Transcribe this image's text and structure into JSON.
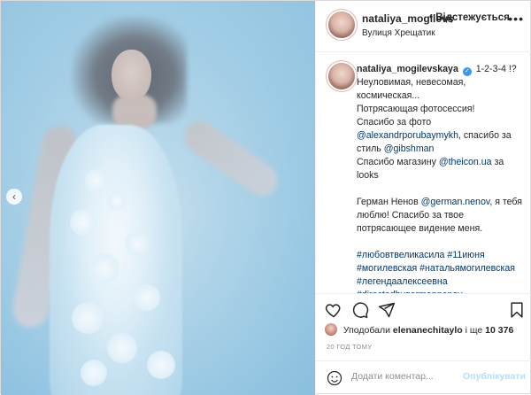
{
  "post": {
    "username": "nataliya_mogilevs",
    "follow_state": "• Відстежується",
    "location": "Вулиця Хрещатик",
    "more": "•••"
  },
  "caption": {
    "username": "nataliya_mogilevskaya",
    "verified": "✓",
    "line_intro": "1-2-3-4 !?",
    "text1": "Неуловимая, невесомая, космическая...",
    "text2": "Потрясающая фотосессия!",
    "text3": "Спасибо за фото",
    "mention_photo": "@alexandrporubaymykh",
    "text4": ", спасибо за стиль",
    "mention_style": "@gibshman",
    "text5": "Спасибо магазину",
    "mention_shop": "@theicon.ua",
    "text6": "за looks",
    "text7": "Герман Ненов",
    "mention_german": "@german.nenov",
    "text8": ", я тебя люблю! Спасибо за твое потрясающее видение меня.",
    "hashtags": "#любовтвеликасила #11июня #могилевская #натальямогилевская #легендаалексеевна #directedbygermannenov #createdbygermannenov #new #soon"
  },
  "likes": {
    "prefix": "Уподобали",
    "user": "elenanechitaylo",
    "suffix": "і ще",
    "count": "10 376"
  },
  "time": "20 ГОД ТОМУ",
  "comment_box": {
    "placeholder": "Додати коментар...",
    "publish": "Опублікувати"
  },
  "colors": {
    "link": "#00376b",
    "verified": "#3897f0",
    "publish_disabled": "#b2dffc"
  },
  "icons": {
    "like": "heart-icon",
    "comment": "comment-icon",
    "share": "share-icon",
    "save": "bookmark-icon",
    "emoji": "smiley-icon",
    "nav": "chevron-left-icon"
  }
}
